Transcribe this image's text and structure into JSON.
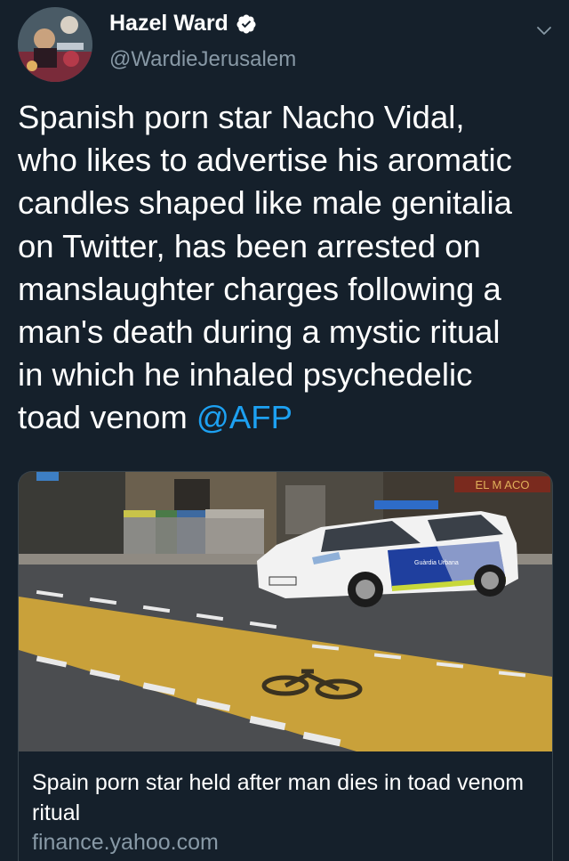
{
  "user": {
    "name": "Hazel Ward",
    "handle": "@WardieJerusalem",
    "verified": true
  },
  "tweet": {
    "lines": [
      "Spanish porn star Nacho Vidal,",
      "who likes to advertise his aromatic",
      "candles shaped like male genitalia",
      "on Twitter, has been arrested on",
      "manslaughter charges following a",
      "man's death during a mystic ritual",
      "in which he inhaled psychedelic"
    ],
    "last_line_text": "toad venom ",
    "mention": "@AFP"
  },
  "card": {
    "image_overlay_sign": "EL M ACO",
    "car_label": "Guàrdia Urbana",
    "title": "Spain porn star held after man dies in toad venom ritual",
    "domain": "finance.yahoo.com"
  },
  "colors": {
    "background": "#15202b",
    "text": "#ffffff",
    "secondary": "#8899a6",
    "accent": "#1da1f2",
    "border": "#38444d"
  },
  "icons": {
    "verified": "verified-badge-icon",
    "menu": "chevron-down-icon"
  }
}
